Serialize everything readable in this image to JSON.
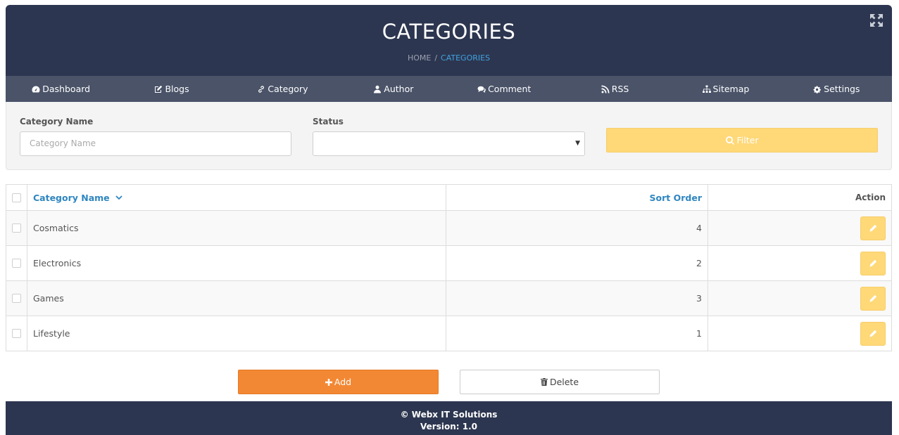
{
  "header": {
    "title": "CATEGORIES",
    "breadcrumb": {
      "home": "HOME",
      "separator": "/",
      "current": "CATEGORIES"
    },
    "fullscreen_icon": "expand-icon"
  },
  "nav": [
    {
      "label": "Dashboard",
      "icon": "dashboard-icon"
    },
    {
      "label": "Blogs",
      "icon": "edit-icon"
    },
    {
      "label": "Category",
      "icon": "link-icon"
    },
    {
      "label": "Author",
      "icon": "user-icon"
    },
    {
      "label": "Comment",
      "icon": "comments-icon"
    },
    {
      "label": "RSS",
      "icon": "rss-icon"
    },
    {
      "label": "Sitemap",
      "icon": "sitemap-icon"
    },
    {
      "label": "Settings",
      "icon": "cogs-icon"
    }
  ],
  "filter": {
    "name_label": "Category Name",
    "name_placeholder": "Category Name",
    "name_value": "",
    "status_label": "Status",
    "status_value": "",
    "button_label": "Filter",
    "button_icon": "search-icon"
  },
  "table": {
    "columns": {
      "name": "Category Name",
      "sort": "Sort Order",
      "action": "Action"
    },
    "sorted_by": "Category Name",
    "rows": [
      {
        "name": "Cosmatics",
        "sort": "4"
      },
      {
        "name": "Electronics",
        "sort": "2"
      },
      {
        "name": "Games",
        "sort": "3"
      },
      {
        "name": "Lifestyle",
        "sort": "1"
      }
    ]
  },
  "actions": {
    "add_label": "Add",
    "delete_label": "Delete"
  },
  "footer": {
    "copyright": "© Webx IT Solutions",
    "version": "Version: 1.0"
  },
  "colors": {
    "header_bg": "#2d3650",
    "nav_bg": "#4a5368",
    "accent_link": "#2f86c0",
    "warning": "#ffd878",
    "add_orange": "#f38834"
  }
}
